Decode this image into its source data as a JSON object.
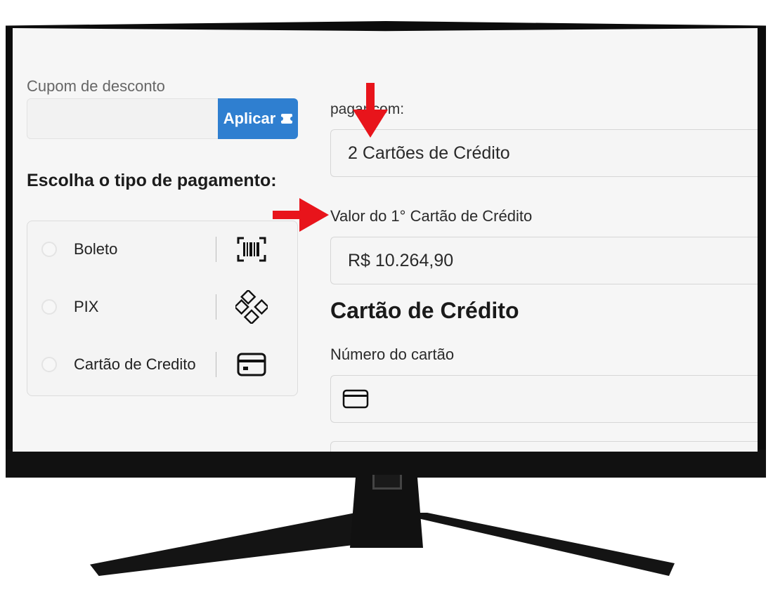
{
  "coupon": {
    "label": "Cupom de desconto",
    "input_value": "",
    "apply_label": "Aplicar"
  },
  "payment_type": {
    "title": "Escolha o tipo de pagamento:",
    "options": [
      {
        "label": "Boleto",
        "icon": "barcode-icon",
        "selected": false
      },
      {
        "label": "PIX",
        "icon": "pix-icon",
        "selected": false
      },
      {
        "label": "Cartão de Credito",
        "icon": "credit-card-icon",
        "selected": false
      }
    ]
  },
  "pay_with": {
    "label": "pagar com:",
    "value": "2 Cartões de Crédito"
  },
  "first_card_amount": {
    "label": "Valor do 1° Cartão de Crédito",
    "value": "R$ 10.264,90"
  },
  "credit_card": {
    "heading": "Cartão de Crédito",
    "number_label": "Número do cartão",
    "number_value": ""
  },
  "colors": {
    "accent": "#2f7fd0",
    "annotation_arrow": "#e8141b",
    "screen_bg": "#f6f6f6"
  }
}
